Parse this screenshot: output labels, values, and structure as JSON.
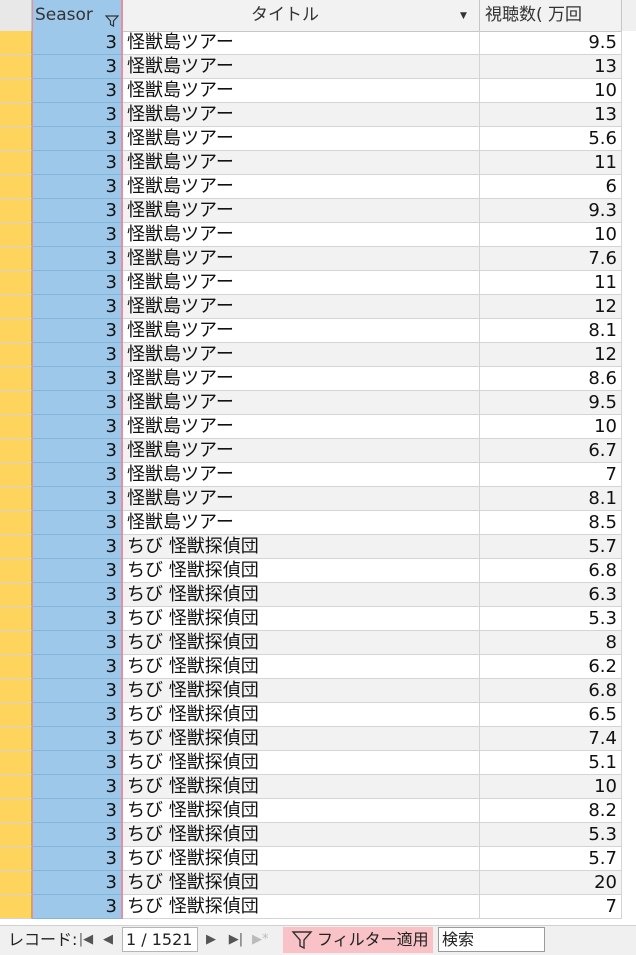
{
  "columns": {
    "season": "Seasor",
    "title": "タイトル",
    "views": "視聴数( 万回"
  },
  "rows": [
    {
      "season": "3",
      "title": "怪獣島ツアー",
      "views": "9.5"
    },
    {
      "season": "3",
      "title": "怪獣島ツアー",
      "views": "13"
    },
    {
      "season": "3",
      "title": "怪獣島ツアー",
      "views": "10"
    },
    {
      "season": "3",
      "title": "怪獣島ツアー",
      "views": "13"
    },
    {
      "season": "3",
      "title": "怪獣島ツアー",
      "views": "5.6"
    },
    {
      "season": "3",
      "title": "怪獣島ツアー",
      "views": "11"
    },
    {
      "season": "3",
      "title": "怪獣島ツアー",
      "views": "6"
    },
    {
      "season": "3",
      "title": "怪獣島ツアー",
      "views": "9.3"
    },
    {
      "season": "3",
      "title": "怪獣島ツアー",
      "views": "10"
    },
    {
      "season": "3",
      "title": "怪獣島ツアー",
      "views": "7.6"
    },
    {
      "season": "3",
      "title": "怪獣島ツアー",
      "views": "11"
    },
    {
      "season": "3",
      "title": "怪獣島ツアー",
      "views": "12"
    },
    {
      "season": "3",
      "title": "怪獣島ツアー",
      "views": "8.1"
    },
    {
      "season": "3",
      "title": "怪獣島ツアー",
      "views": "12"
    },
    {
      "season": "3",
      "title": "怪獣島ツアー",
      "views": "8.6"
    },
    {
      "season": "3",
      "title": "怪獣島ツアー",
      "views": "9.5"
    },
    {
      "season": "3",
      "title": "怪獣島ツアー",
      "views": "10"
    },
    {
      "season": "3",
      "title": "怪獣島ツアー",
      "views": "6.7"
    },
    {
      "season": "3",
      "title": "怪獣島ツアー",
      "views": "7"
    },
    {
      "season": "3",
      "title": "怪獣島ツアー",
      "views": "8.1"
    },
    {
      "season": "3",
      "title": "怪獣島ツアー",
      "views": "8.5"
    },
    {
      "season": "3",
      "title": "ちび 怪獣探偵団",
      "views": "5.7"
    },
    {
      "season": "3",
      "title": "ちび 怪獣探偵団",
      "views": "6.8"
    },
    {
      "season": "3",
      "title": "ちび 怪獣探偵団",
      "views": "6.3"
    },
    {
      "season": "3",
      "title": "ちび 怪獣探偵団",
      "views": "5.3"
    },
    {
      "season": "3",
      "title": "ちび 怪獣探偵団",
      "views": "8"
    },
    {
      "season": "3",
      "title": "ちび 怪獣探偵団",
      "views": "6.2"
    },
    {
      "season": "3",
      "title": "ちび 怪獣探偵団",
      "views": "6.8"
    },
    {
      "season": "3",
      "title": "ちび 怪獣探偵団",
      "views": "6.5"
    },
    {
      "season": "3",
      "title": "ちび 怪獣探偵団",
      "views": "7.4"
    },
    {
      "season": "3",
      "title": "ちび 怪獣探偵団",
      "views": "5.1"
    },
    {
      "season": "3",
      "title": "ちび 怪獣探偵団",
      "views": "10"
    },
    {
      "season": "3",
      "title": "ちび 怪獣探偵団",
      "views": "8.2"
    },
    {
      "season": "3",
      "title": "ちび 怪獣探偵団",
      "views": "5.3"
    },
    {
      "season": "3",
      "title": "ちび 怪獣探偵団",
      "views": "5.7"
    },
    {
      "season": "3",
      "title": "ちび 怪獣探偵団",
      "views": "20"
    },
    {
      "season": "3",
      "title": "ちび 怪獣探偵団",
      "views": "7"
    }
  ],
  "navigator": {
    "label": "レコード:",
    "first_icon": "first-record-icon",
    "prev_icon": "previous-record-icon",
    "record_position": "1 / 1521",
    "next_icon": "next-record-icon",
    "last_icon": "last-record-icon",
    "new_icon": "new-record-icon",
    "filter_icon": "filter-icon",
    "filter_label": "フィルター適用",
    "search_placeholder": "検索"
  },
  "colors": {
    "selector": "#ffd45c",
    "season_column": "#9ec8ea",
    "filter_badge": "#f8c2c6",
    "alt_row": "#f2f2f2"
  }
}
